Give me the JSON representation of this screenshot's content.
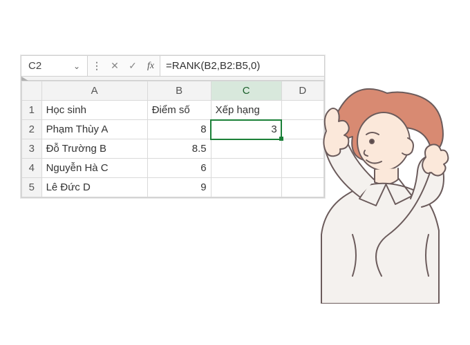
{
  "formula_bar": {
    "cell_ref": "C2",
    "formula": "=RANK(B2,B2:B5,0)"
  },
  "columns": [
    "A",
    "B",
    "C",
    "D"
  ],
  "row_numbers": [
    "1",
    "2",
    "3",
    "4",
    "5"
  ],
  "headers": {
    "hoc_sinh": "Học sinh",
    "diem_so": "Điểm số",
    "xep_hang": "Xếp hạng"
  },
  "rows": [
    {
      "name": "Phạm Thùy A",
      "score": "8",
      "rank": "3"
    },
    {
      "name": "Đỗ Trường B",
      "score": "8.5",
      "rank": ""
    },
    {
      "name": "Nguyễn Hà C",
      "score": "6",
      "rank": ""
    },
    {
      "name": "Lê Đức D",
      "score": "9",
      "rank": ""
    }
  ],
  "icons": {
    "chevron": "⌄",
    "kebab": "⋮",
    "cancel": "✕",
    "accept": "✓",
    "fx": "fx"
  }
}
